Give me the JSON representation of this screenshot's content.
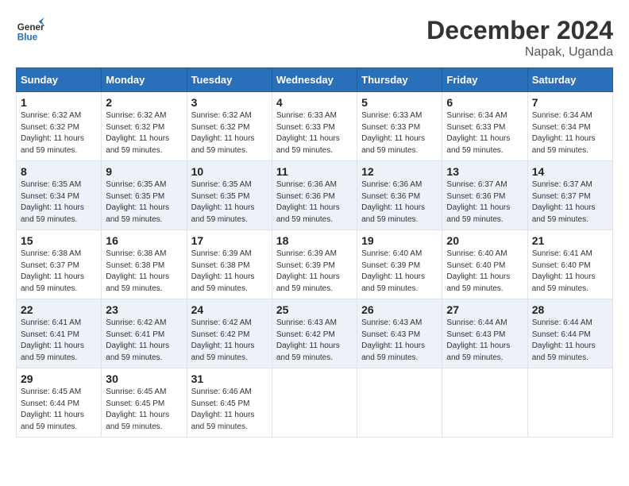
{
  "header": {
    "logo_line1": "General",
    "logo_line2": "Blue",
    "month": "December 2024",
    "location": "Napak, Uganda"
  },
  "days_of_week": [
    "Sunday",
    "Monday",
    "Tuesday",
    "Wednesday",
    "Thursday",
    "Friday",
    "Saturday"
  ],
  "weeks": [
    [
      {
        "day": "1",
        "sunrise": "6:32 AM",
        "sunset": "6:32 PM",
        "daylight": "11 hours and 59 minutes."
      },
      {
        "day": "2",
        "sunrise": "6:32 AM",
        "sunset": "6:32 PM",
        "daylight": "11 hours and 59 minutes."
      },
      {
        "day": "3",
        "sunrise": "6:32 AM",
        "sunset": "6:32 PM",
        "daylight": "11 hours and 59 minutes."
      },
      {
        "day": "4",
        "sunrise": "6:33 AM",
        "sunset": "6:33 PM",
        "daylight": "11 hours and 59 minutes."
      },
      {
        "day": "5",
        "sunrise": "6:33 AM",
        "sunset": "6:33 PM",
        "daylight": "11 hours and 59 minutes."
      },
      {
        "day": "6",
        "sunrise": "6:34 AM",
        "sunset": "6:33 PM",
        "daylight": "11 hours and 59 minutes."
      },
      {
        "day": "7",
        "sunrise": "6:34 AM",
        "sunset": "6:34 PM",
        "daylight": "11 hours and 59 minutes."
      }
    ],
    [
      {
        "day": "8",
        "sunrise": "6:35 AM",
        "sunset": "6:34 PM",
        "daylight": "11 hours and 59 minutes."
      },
      {
        "day": "9",
        "sunrise": "6:35 AM",
        "sunset": "6:35 PM",
        "daylight": "11 hours and 59 minutes."
      },
      {
        "day": "10",
        "sunrise": "6:35 AM",
        "sunset": "6:35 PM",
        "daylight": "11 hours and 59 minutes."
      },
      {
        "day": "11",
        "sunrise": "6:36 AM",
        "sunset": "6:36 PM",
        "daylight": "11 hours and 59 minutes."
      },
      {
        "day": "12",
        "sunrise": "6:36 AM",
        "sunset": "6:36 PM",
        "daylight": "11 hours and 59 minutes."
      },
      {
        "day": "13",
        "sunrise": "6:37 AM",
        "sunset": "6:36 PM",
        "daylight": "11 hours and 59 minutes."
      },
      {
        "day": "14",
        "sunrise": "6:37 AM",
        "sunset": "6:37 PM",
        "daylight": "11 hours and 59 minutes."
      }
    ],
    [
      {
        "day": "15",
        "sunrise": "6:38 AM",
        "sunset": "6:37 PM",
        "daylight": "11 hours and 59 minutes."
      },
      {
        "day": "16",
        "sunrise": "6:38 AM",
        "sunset": "6:38 PM",
        "daylight": "11 hours and 59 minutes."
      },
      {
        "day": "17",
        "sunrise": "6:39 AM",
        "sunset": "6:38 PM",
        "daylight": "11 hours and 59 minutes."
      },
      {
        "day": "18",
        "sunrise": "6:39 AM",
        "sunset": "6:39 PM",
        "daylight": "11 hours and 59 minutes."
      },
      {
        "day": "19",
        "sunrise": "6:40 AM",
        "sunset": "6:39 PM",
        "daylight": "11 hours and 59 minutes."
      },
      {
        "day": "20",
        "sunrise": "6:40 AM",
        "sunset": "6:40 PM",
        "daylight": "11 hours and 59 minutes."
      },
      {
        "day": "21",
        "sunrise": "6:41 AM",
        "sunset": "6:40 PM",
        "daylight": "11 hours and 59 minutes."
      }
    ],
    [
      {
        "day": "22",
        "sunrise": "6:41 AM",
        "sunset": "6:41 PM",
        "daylight": "11 hours and 59 minutes."
      },
      {
        "day": "23",
        "sunrise": "6:42 AM",
        "sunset": "6:41 PM",
        "daylight": "11 hours and 59 minutes."
      },
      {
        "day": "24",
        "sunrise": "6:42 AM",
        "sunset": "6:42 PM",
        "daylight": "11 hours and 59 minutes."
      },
      {
        "day": "25",
        "sunrise": "6:43 AM",
        "sunset": "6:42 PM",
        "daylight": "11 hours and 59 minutes."
      },
      {
        "day": "26",
        "sunrise": "6:43 AM",
        "sunset": "6:43 PM",
        "daylight": "11 hours and 59 minutes."
      },
      {
        "day": "27",
        "sunrise": "6:44 AM",
        "sunset": "6:43 PM",
        "daylight": "11 hours and 59 minutes."
      },
      {
        "day": "28",
        "sunrise": "6:44 AM",
        "sunset": "6:44 PM",
        "daylight": "11 hours and 59 minutes."
      }
    ],
    [
      {
        "day": "29",
        "sunrise": "6:45 AM",
        "sunset": "6:44 PM",
        "daylight": "11 hours and 59 minutes."
      },
      {
        "day": "30",
        "sunrise": "6:45 AM",
        "sunset": "6:45 PM",
        "daylight": "11 hours and 59 minutes."
      },
      {
        "day": "31",
        "sunrise": "6:46 AM",
        "sunset": "6:45 PM",
        "daylight": "11 hours and 59 minutes."
      },
      null,
      null,
      null,
      null
    ]
  ]
}
